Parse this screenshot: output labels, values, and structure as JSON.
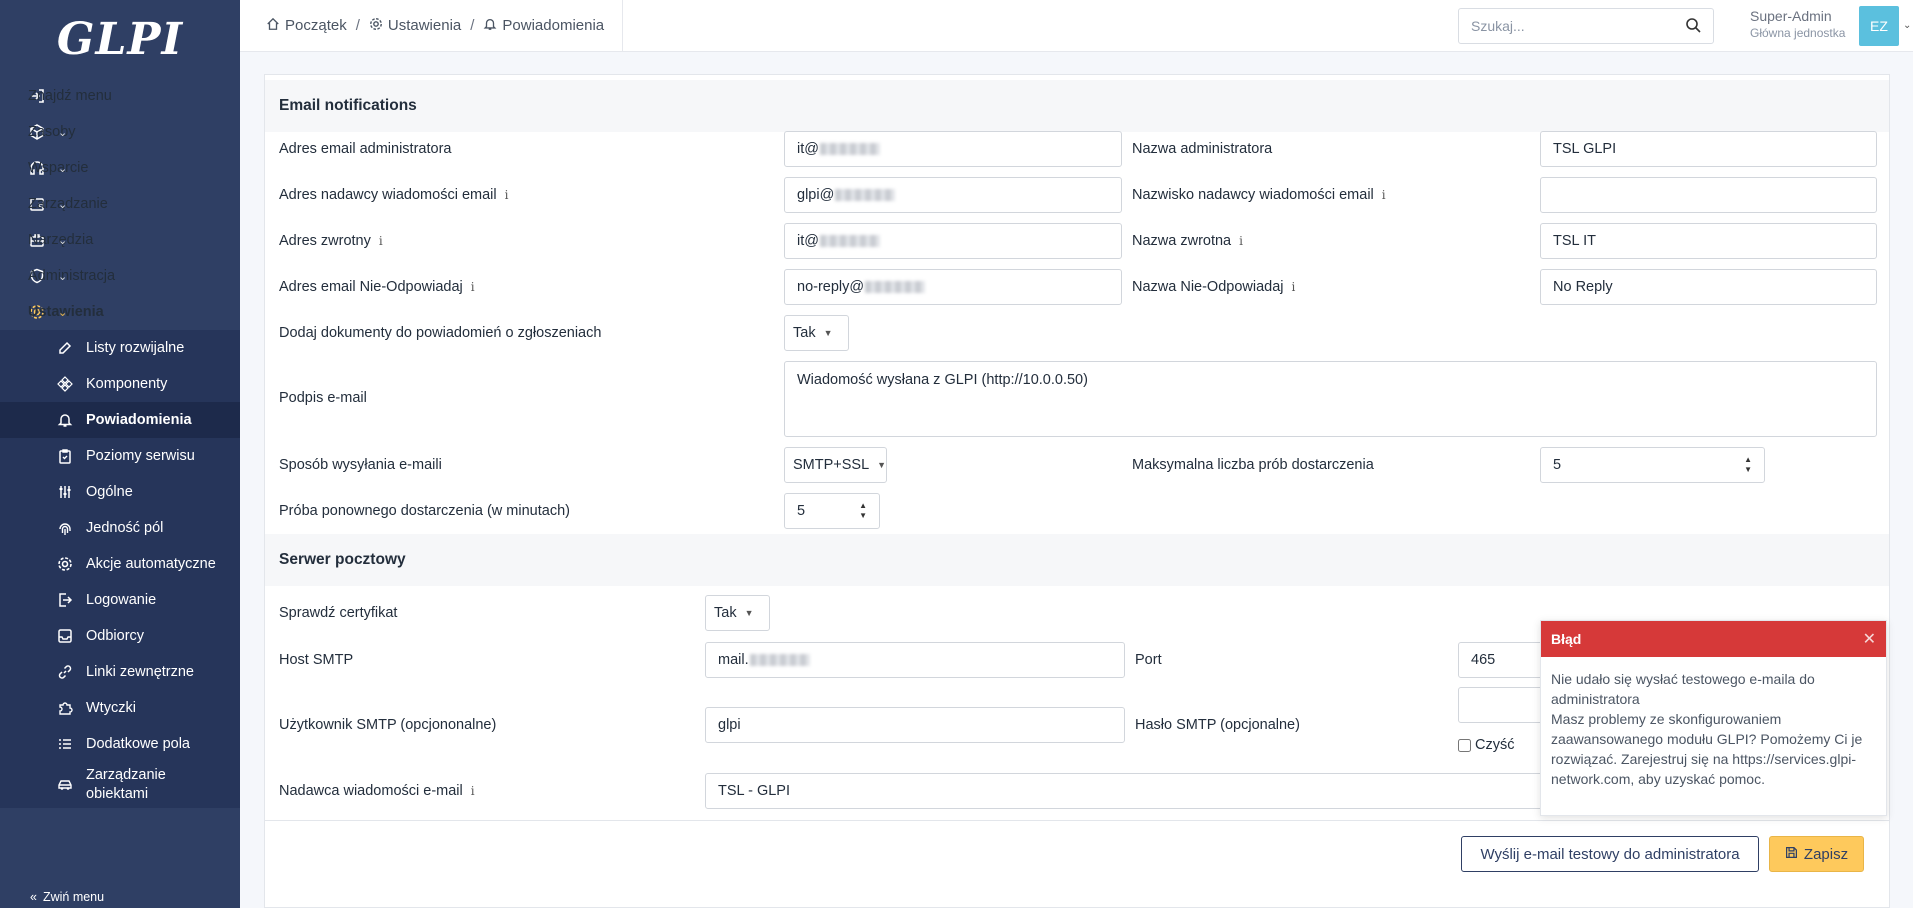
{
  "app": {
    "logo": "GLPI"
  },
  "sidebar": {
    "find_menu": "Znajdź menu",
    "items": [
      {
        "label": "Zasoby",
        "icon": "box-icon"
      },
      {
        "label": "Wsparcie",
        "icon": "headset-icon"
      },
      {
        "label": "Zarządzanie",
        "icon": "wallet-icon"
      },
      {
        "label": "Narzędzia",
        "icon": "briefcase-icon"
      },
      {
        "label": "Administracja",
        "icon": "shield-icon"
      },
      {
        "label": "Ustawienia",
        "icon": "gear-icon"
      }
    ],
    "sub_items": [
      "Listy rozwijalne",
      "Komponenty",
      "Powiadomienia",
      "Poziomy serwisu",
      "Ogólne",
      "Jedność pól",
      "Akcje automatyczne",
      "Logowanie",
      "Odbiorcy",
      "Linki zewnętrzne",
      "Wtyczki",
      "Dodatkowe pola",
      "Zarządzanie obiektami"
    ],
    "collapse": "Zwiń menu",
    "active_color": "#fec95c"
  },
  "header": {
    "breadcrumb": [
      "Początek",
      "Ustawienia",
      "Powiadomienia"
    ],
    "search_placeholder": "Szukaj...",
    "user_name": "Super-Admin",
    "entity": "Główna jednostka",
    "avatar": "EZ"
  },
  "email": {
    "section_title": "Email notifications",
    "admin_email_label": "Adres email administratora",
    "admin_email_value": "it@",
    "admin_name_label": "Nazwa administratora",
    "admin_name_value": "TSL GLPI",
    "sender_email_label": "Adres nadawcy wiadomości email",
    "sender_email_value": "glpi@",
    "sender_name_label": "Nazwisko nadawcy wiadomości email",
    "sender_name_value": "",
    "reply_email_label": "Adres zwrotny",
    "reply_email_value": "it@",
    "reply_name_label": "Nazwa zwrotna",
    "reply_name_value": "TSL IT",
    "noreply_email_label": "Adres email Nie-Odpowiadaj",
    "noreply_email_value": "no-reply@",
    "noreply_name_label": "Nazwa Nie-Odpowiadaj",
    "noreply_name_value": "No Reply",
    "attach_docs_label": "Dodaj dokumenty do powiadomień o zgłoszeniach",
    "attach_docs_value": "Tak",
    "signature_label": "Podpis e-mail",
    "signature_value": "Wiadomość wysłana z GLPI (http://10.0.0.50)",
    "send_method_label": "Sposób wysyłania e-maili",
    "send_method_value": "SMTP+SSL",
    "max_tries_label": "Maksymalna liczba prób dostarczenia",
    "max_tries_value": "5",
    "retry_label": "Próba ponownego dostarczenia (w minutach)",
    "retry_value": "5"
  },
  "smtp": {
    "section_title": "Serwer pocztowy",
    "check_cert_label": "Sprawdź certyfikat",
    "check_cert_value": "Tak",
    "host_label": "Host SMTP",
    "host_value": "mail.",
    "port_label": "Port",
    "port_value": "465",
    "user_label": "Użytkownik SMTP (opcjononalne)",
    "user_value": "glpi",
    "password_label": "Hasło SMTP (opcjonalne)",
    "clear_label": "Czyść",
    "from_label": "Nadawca wiadomości e-mail",
    "from_value": "TSL - GLPI"
  },
  "actions": {
    "test_button": "Wyślij e-mail testowy do administratora",
    "save_button": "Zapisz"
  },
  "toast": {
    "title": "Błąd",
    "line1": "Nie udało się wysłać testowego e-maila do administratora",
    "line2": "Masz problemy ze skonfigurowaniem zaawansowanego modułu GLPI? Pomożemy Ci je rozwiązać. Zarejestruj się na",
    "link": "https://services.glpi-network.com",
    "line3": ", aby uzyskać pomoc.",
    "color": "#d63939"
  }
}
